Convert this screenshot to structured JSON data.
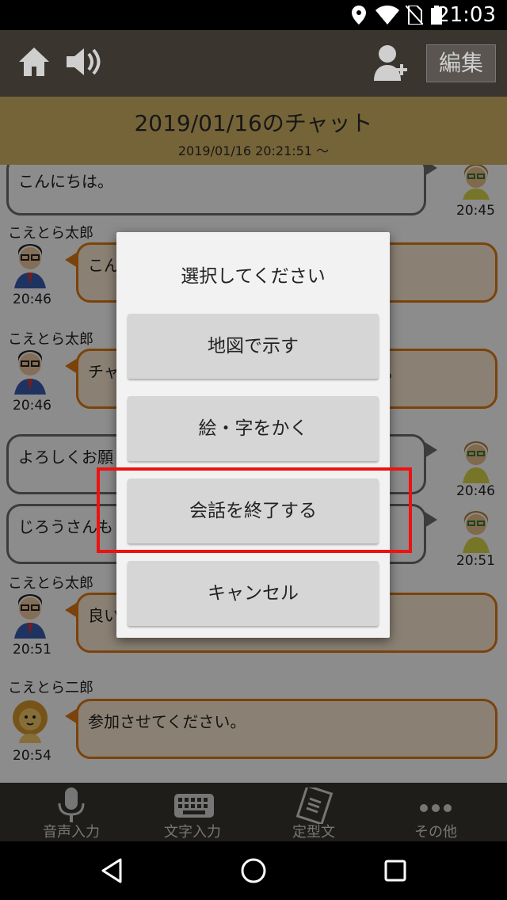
{
  "status_bar": {
    "time": "21:03"
  },
  "toolbar": {
    "edit_label": "編集"
  },
  "chat_header": {
    "title": "2019/01/16のチャット",
    "subtitle": "2019/01/16 20:21:51 〜"
  },
  "messages": [
    {
      "direction": "out",
      "text": "こんにちは。",
      "time": "20:45"
    },
    {
      "direction": "in",
      "sender": "こえとら太郎",
      "text": "こん",
      "time": "20:46"
    },
    {
      "direction": "in",
      "sender": "こえとら太郎",
      "text": "チャ",
      "text_right": "。",
      "time": "20:46"
    },
    {
      "direction": "out",
      "text": "よろしくお願",
      "time": "20:46"
    },
    {
      "direction": "out",
      "text": "じろうさんも",
      "time": "20:51"
    },
    {
      "direction": "in",
      "sender": "こえとら太郎",
      "text": "良い",
      "time": "20:51"
    },
    {
      "direction": "in",
      "sender": "こえとら二郎",
      "text": "参加させてください。",
      "time": "20:54"
    }
  ],
  "dialog": {
    "title": "選択してください",
    "buttons": [
      "地図で示す",
      "絵・字をかく",
      "会話を終了する",
      "キャンセル"
    ],
    "highlighted_index": 2,
    "highlight_color": "#ee1111"
  },
  "bottom_nav": {
    "items": [
      {
        "label": "音声入力",
        "icon": "microphone-icon"
      },
      {
        "label": "文字入力",
        "icon": "keyboard-icon"
      },
      {
        "label": "定型文",
        "icon": "document-icon"
      },
      {
        "label": "その他",
        "icon": "more-icon"
      }
    ]
  },
  "colors": {
    "toolbar": "#3a352f",
    "header": "#d8b769",
    "incoming_border": "#e07a14",
    "outgoing_border": "#6d6d6d"
  }
}
